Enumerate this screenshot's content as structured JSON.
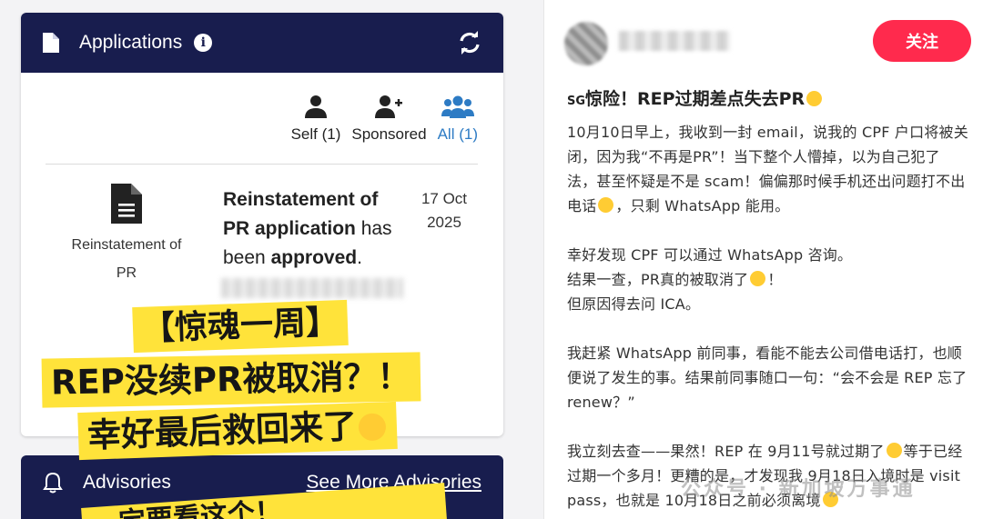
{
  "app_card": {
    "header_title": "Applications",
    "info_glyph": "i",
    "filters": [
      {
        "label": "Self (1)",
        "icon": "user-icon"
      },
      {
        "label": "Sponsored",
        "icon": "user-plus-icon"
      },
      {
        "label": "All (1)",
        "icon": "users-icon",
        "active": true
      }
    ],
    "row": {
      "type_label_line1": "Reinstatement of",
      "type_label_line2": "PR",
      "desc_bold1": "Reinstatement of PR application",
      "desc_text1": " has been ",
      "desc_bold2": "approved",
      "desc_text2": ".",
      "date_line1": "17 Oct",
      "date_line2": "2025"
    }
  },
  "advisories_card": {
    "title": "Advisories",
    "link": "See More Advisories"
  },
  "overlay": {
    "line1": "【惊魂一周】",
    "line2": "REP没续PR被取消？！",
    "line3": "幸好最后救回来了",
    "line4": "一定要看这个！"
  },
  "post": {
    "follow_label": "关注",
    "title_prefix": "SG",
    "title": "惊险！REP过期差点失去PR",
    "p1": "10月10日早上，我收到一封 email，说我的 CPF 户口将被关闭，因为我“不再是PR”！当下整个人懵掉，以为自己犯了法，甚至怀疑是不是 scam！偏偏那时候手机还出问题打不出电话",
    "p1_tail": "，只剩 WhatsApp 能用。",
    "p2_l1": "幸好发现 CPF 可以通过 WhatsApp 咨询。",
    "p2_l2": "结果一查，PR真的被取消了",
    "p2_l2_tail": "！",
    "p2_l3": "但原因得去问 ICA。",
    "p3": "我赶紧 WhatsApp 前同事，看能不能去公司借电话打，也顺便说了发生的事。结果前同事随口一句：“会不会是 REP 忘了 renew？”",
    "p4": "我立刻去查——果然！REP 在 9月11号就过期了",
    "p4_tail": "等于已经过期一个多月！更糟的是，才发现我 9月18日入境时是 visit pass，也就是 10月18日之前必须离境",
    "watermark": "公众号 · 新加坡万事通"
  },
  "colors": {
    "navy": "#181d4e",
    "accent_blue": "#2d7bc4",
    "follow_red": "#ff2a4d",
    "sticker_yellow": "#ffe33a"
  }
}
